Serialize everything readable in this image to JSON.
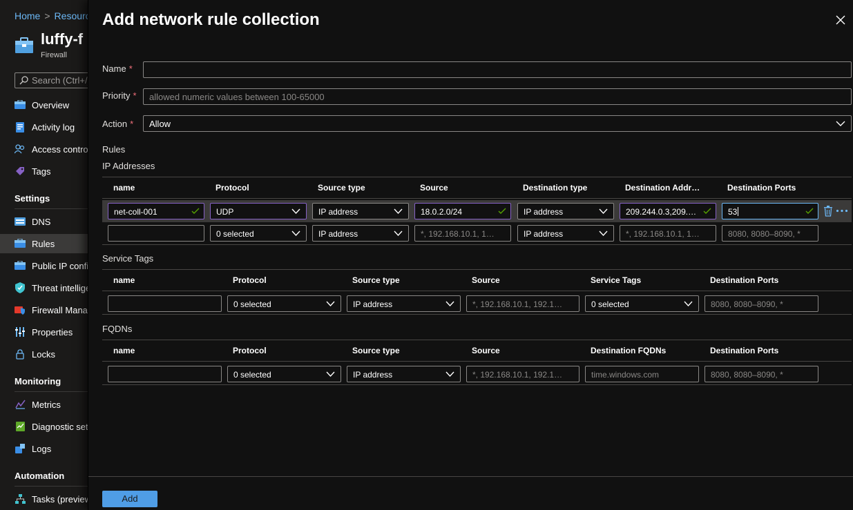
{
  "portal": {
    "breadcrumb": [
      "Home",
      "Resource"
    ],
    "resource_title": "luffy-f",
    "resource_subtitle": "Firewall",
    "search_placeholder": "Search (Ctrl+/)",
    "nav_top": [
      {
        "label": "Overview",
        "icon": "overview-icon"
      },
      {
        "label": "Activity log",
        "icon": "activity-log-icon"
      },
      {
        "label": "Access control (IAM)",
        "icon": "access-control-icon"
      },
      {
        "label": "Tags",
        "icon": "tag-icon"
      }
    ],
    "settings_heading": "Settings",
    "nav_settings": [
      {
        "label": "DNS",
        "icon": "dns-icon"
      },
      {
        "label": "Rules",
        "icon": "rules-icon",
        "active": true
      },
      {
        "label": "Public IP configuration",
        "icon": "public-ip-icon"
      },
      {
        "label": "Threat intelligence",
        "icon": "threat-intel-icon"
      },
      {
        "label": "Firewall Manager",
        "icon": "firewall-manager-icon"
      },
      {
        "label": "Properties",
        "icon": "properties-icon"
      },
      {
        "label": "Locks",
        "icon": "lock-icon"
      }
    ],
    "monitoring_heading": "Monitoring",
    "nav_monitoring": [
      {
        "label": "Metrics",
        "icon": "metrics-icon"
      },
      {
        "label": "Diagnostic settings",
        "icon": "diagnostic-icon"
      },
      {
        "label": "Logs",
        "icon": "logs-icon"
      }
    ],
    "automation_heading": "Automation",
    "nav_automation": [
      {
        "label": "Tasks (preview)",
        "icon": "tasks-icon"
      }
    ]
  },
  "blade": {
    "title": "Add network rule collection",
    "name_label": "Name",
    "name_value": "",
    "priority_label": "Priority",
    "priority_placeholder": "allowed numeric values between 100-65000",
    "action_label": "Action",
    "action_value": "Allow",
    "rules_heading": "Rules",
    "ip_section": {
      "heading": "IP Addresses",
      "headers": [
        "name",
        "Protocol",
        "Source type",
        "Source",
        "Destination type",
        "Destination Addr…",
        "Destination Ports"
      ],
      "row1": {
        "name": "net-coll-001",
        "protocol": "UDP",
        "source_type": "IP address",
        "source": "18.0.2.0/24",
        "destination_type": "IP address",
        "destination_address": "209.244.0.3,209.2…",
        "destination_ports": "53"
      },
      "row2": {
        "protocol": "0 selected",
        "source_type": "IP address",
        "source_placeholder": "*, 192.168.10.1, 192…",
        "destination_type": "IP address",
        "destination_placeholder": "*, 192.168.10.1, 192…",
        "ports_placeholder": "8080, 8080–8090, *"
      }
    },
    "tags_section": {
      "heading": "Service Tags",
      "headers": [
        "name",
        "Protocol",
        "Source type",
        "Source",
        "Service Tags",
        "Destination Ports"
      ],
      "row": {
        "protocol": "0 selected",
        "source_type": "IP address",
        "source_placeholder": "*, 192.168.10.1, 192.168…",
        "service_tags": "0 selected",
        "ports_placeholder": "8080, 8080–8090, *"
      }
    },
    "fqdn_section": {
      "heading": "FQDNs",
      "headers": [
        "name",
        "Protocol",
        "Source type",
        "Source",
        "Destination FQDNs",
        "Destination Ports"
      ],
      "row": {
        "protocol": "0 selected",
        "source_type": "IP address",
        "source_placeholder": "*, 192.168.10.1, 192.168…",
        "fqdn_placeholder": "time.windows.com",
        "ports_placeholder": "8080, 8080–8090, *"
      }
    },
    "add_button": "Add"
  },
  "colors": {
    "accent": "#4f9de6",
    "link": "#6cb8f6",
    "required": "#f1707b",
    "valid_check": "#57a300",
    "valid_border": "#8661c5"
  }
}
